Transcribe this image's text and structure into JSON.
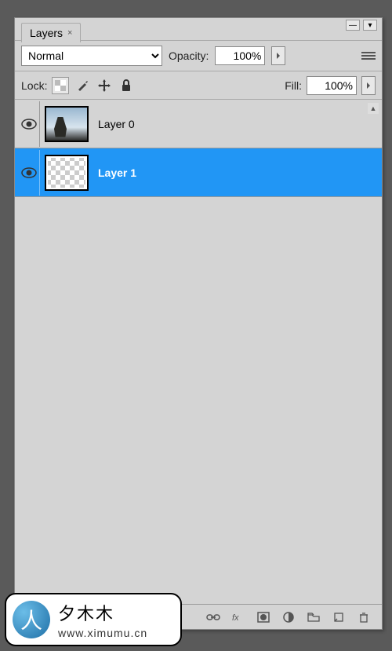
{
  "panel": {
    "tab_title": "Layers",
    "tab_close": "×",
    "minimize": "—",
    "collapse": "▾"
  },
  "options": {
    "blend_mode": "Normal",
    "opacity_label": "Opacity:",
    "opacity_value": "100%",
    "fill_label": "Fill:",
    "fill_value": "100%",
    "lock_label": "Lock:"
  },
  "layers": [
    {
      "name": "Layer 0",
      "visible": true,
      "selected": false,
      "thumb": "image"
    },
    {
      "name": "Layer 1",
      "visible": true,
      "selected": true,
      "thumb": "transparent"
    }
  ],
  "watermark": {
    "title": "夕木木",
    "url": "www.ximumu.cn"
  },
  "colors": {
    "selection": "#2196f5",
    "panel_bg": "#d4d4d4"
  }
}
